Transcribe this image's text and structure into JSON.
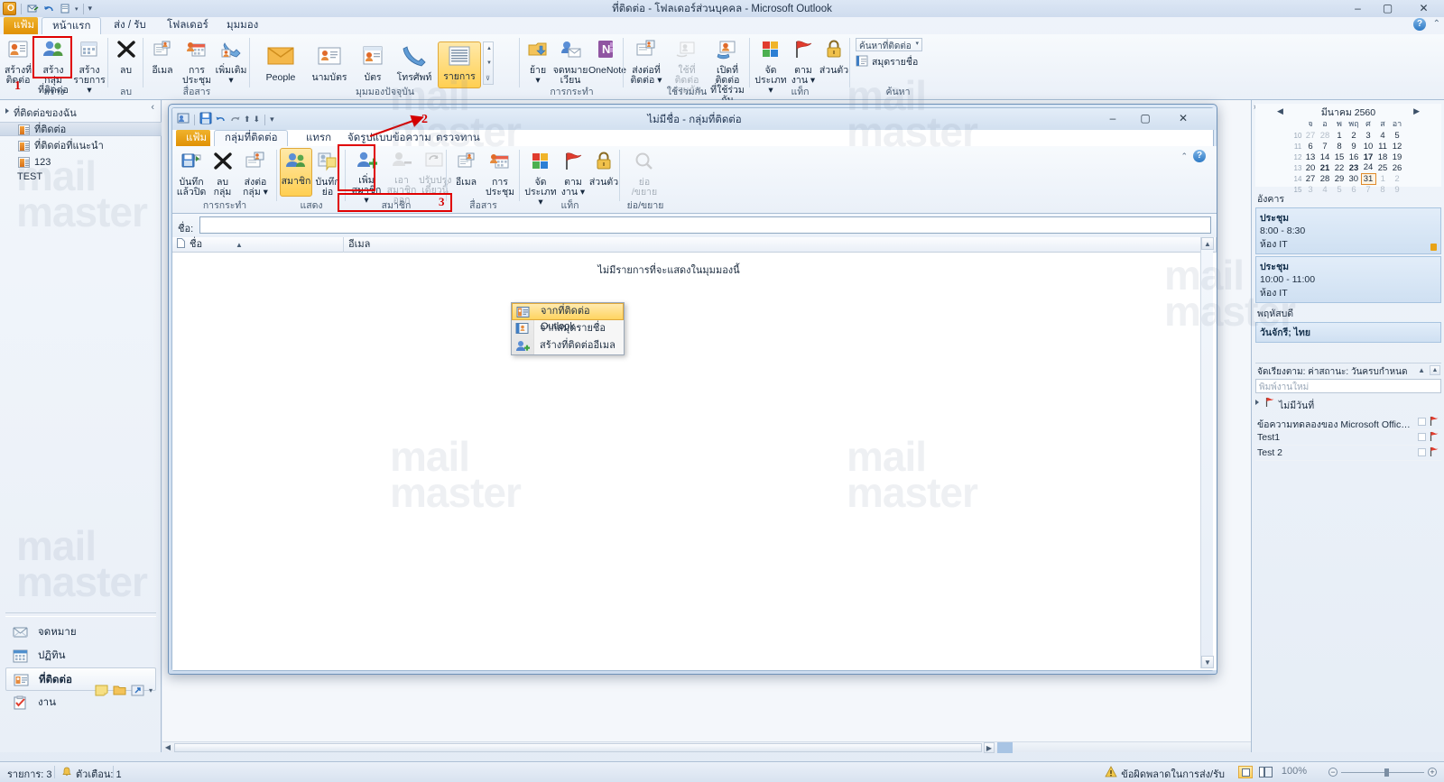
{
  "window": {
    "title": "ที่ติดต่อ - โฟลเดอร์ส่วนบุคคล  -  Microsoft Outlook",
    "minimize": "‒",
    "maximize": "▢",
    "close": "✕"
  },
  "qat": {
    "items": [
      "outlook-logo",
      "send-receive-icon",
      "undo-icon",
      "print-icon",
      "customize-icon"
    ]
  },
  "tabs": [
    {
      "id": "file",
      "label": "แฟ้ม"
    },
    {
      "id": "home",
      "label": "หน้าแรก"
    },
    {
      "id": "send",
      "label": "ส่ง / รับ"
    },
    {
      "id": "folder",
      "label": "โฟลเดอร์"
    },
    {
      "id": "view",
      "label": "มุมมอง"
    }
  ],
  "ribbon": {
    "groups": [
      {
        "name": "สร้าง",
        "buttons": [
          {
            "label": "สร้างที่\nติดต่อ",
            "icon": "new-contact-icon"
          },
          {
            "label": "สร้างกลุ่ม\nที่ติดต่อ",
            "icon": "new-contact-group-icon",
            "highlight": true
          },
          {
            "label": "สร้าง\nรายการ ▾",
            "icon": "new-items-icon"
          }
        ]
      },
      {
        "name": "ลบ",
        "buttons": [
          {
            "label": "ลบ",
            "icon": "delete-x-icon"
          }
        ]
      },
      {
        "name": "สื่อสาร",
        "buttons": [
          {
            "label": "อีเมล",
            "icon": "email-icon"
          },
          {
            "label": "การ\nประชุม",
            "icon": "meeting-icon"
          },
          {
            "label": "เพิ่มเติม\n▾",
            "icon": "more-icon"
          }
        ]
      },
      {
        "name": "มุมมองปัจจุบัน",
        "buttons": [
          {
            "label": "People",
            "icon": "people-view-icon"
          },
          {
            "label": "นามบัตร",
            "icon": "business-card-icon"
          },
          {
            "label": "บัตร",
            "icon": "card-icon"
          },
          {
            "label": "โทรศัพท์",
            "icon": "phone-icon"
          },
          {
            "label": "รายการ",
            "icon": "list-icon",
            "selected": true
          }
        ]
      },
      {
        "name": "การกระทำ",
        "buttons": [
          {
            "label": "ย้าย\n▾",
            "icon": "move-icon"
          },
          {
            "label": "จดหมาย\nเวียน",
            "icon": "mail-merge-icon"
          },
          {
            "label": "OneNote",
            "icon": "onenote-icon"
          }
        ]
      },
      {
        "name": "ใช้ร่วมกัน",
        "buttons": [
          {
            "label": "ส่งต่อที่\nติดต่อ ▾",
            "icon": "forward-contact-icon"
          },
          {
            "label": "ใช้ที่ติดต่อ\nร่วมกัน",
            "icon": "share-contacts-icon",
            "disabled": true
          },
          {
            "label": "เปิดที่ติดต่อ\nที่ใช้ร่วมกัน",
            "icon": "open-shared-contacts-icon"
          }
        ]
      },
      {
        "name": "แท็ก",
        "buttons": [
          {
            "label": "จัด\nประเภท ▾",
            "icon": "categorize-icon"
          },
          {
            "label": "ตาม\nงาน ▾",
            "icon": "follow-up-flag-icon"
          },
          {
            "label": "ส่วนตัว",
            "icon": "private-lock-icon"
          }
        ]
      },
      {
        "name": "ค้นหา",
        "search_placeholder": "ค้นหาที่ติดต่อ",
        "address_book_label": "สมุดรายชื่อ"
      }
    ]
  },
  "navpane": {
    "header": "ที่ติดต่อของฉัน",
    "collapse_icon": "chevron-left-icon",
    "items": [
      {
        "label": "ที่ติดต่อ",
        "selected": true
      },
      {
        "label": "ที่ติดต่อที่แนะนำ",
        "selected": false
      },
      {
        "label": "123",
        "selected": false
      }
    ],
    "extra_item": "TEST",
    "modules": [
      {
        "label": "จดหมาย",
        "icon": "mail-module-icon",
        "selected": false
      },
      {
        "label": "ปฏิทิน",
        "icon": "calendar-module-icon",
        "selected": false
      },
      {
        "label": "ที่ติดต่อ",
        "icon": "contacts-module-icon",
        "selected": true
      },
      {
        "label": "งาน",
        "icon": "tasks-module-icon",
        "selected": false
      }
    ],
    "module_icons": [
      "notes-icon",
      "folder-list-icon",
      "shortcuts-icon",
      "configure-icon"
    ]
  },
  "main": {
    "empty_text": "ไม่มีรายการที่จะแสดงในมุมมองนี้"
  },
  "todo": {
    "date_nav": {
      "month": "มีนาคม 2560",
      "prev": "◀",
      "next": "▶",
      "dow": [
        "จ",
        "อ",
        "พ",
        "พฤ",
        "ศ",
        "ส",
        "อา"
      ],
      "weeks": [
        {
          "wk": "10",
          "days": [
            {
              "d": "27",
              "out": true
            },
            {
              "d": "28",
              "out": true
            },
            {
              "d": "1"
            },
            {
              "d": "2"
            },
            {
              "d": "3"
            },
            {
              "d": "4"
            },
            {
              "d": "5"
            }
          ]
        },
        {
          "wk": "11",
          "days": [
            {
              "d": "6"
            },
            {
              "d": "7"
            },
            {
              "d": "8"
            },
            {
              "d": "9"
            },
            {
              "d": "10"
            },
            {
              "d": "11"
            },
            {
              "d": "12"
            }
          ]
        },
        {
          "wk": "12",
          "days": [
            {
              "d": "13"
            },
            {
              "d": "14"
            },
            {
              "d": "15"
            },
            {
              "d": "16"
            },
            {
              "d": "17",
              "bold": true
            },
            {
              "d": "18"
            },
            {
              "d": "19"
            }
          ]
        },
        {
          "wk": "13",
          "days": [
            {
              "d": "20"
            },
            {
              "d": "21",
              "bold": true
            },
            {
              "d": "22"
            },
            {
              "d": "23",
              "bold": true
            },
            {
              "d": "24"
            },
            {
              "d": "25"
            },
            {
              "d": "26"
            }
          ]
        },
        {
          "wk": "14",
          "days": [
            {
              "d": "27"
            },
            {
              "d": "28"
            },
            {
              "d": "29"
            },
            {
              "d": "30"
            },
            {
              "d": "31",
              "today": true
            },
            {
              "d": "1",
              "out": true
            },
            {
              "d": "2",
              "out": true
            }
          ]
        },
        {
          "wk": "15",
          "days": [
            {
              "d": "3",
              "out": true
            },
            {
              "d": "4",
              "out": true
            },
            {
              "d": "5",
              "out": true
            },
            {
              "d": "6",
              "out": true
            },
            {
              "d": "7",
              "out": true
            },
            {
              "d": "8",
              "out": true
            },
            {
              "d": "9",
              "out": true
            }
          ]
        }
      ]
    },
    "appointment_groups": [
      {
        "day": "อังคาร",
        "items": [
          {
            "subject": "ประชุม",
            "time": "8:00 - 8:30",
            "location": "ห้อง IT",
            "private": true
          },
          {
            "subject": "ประชุม",
            "time": "10:00 - 11:00",
            "location": "ห้อง IT",
            "private": false
          }
        ]
      },
      {
        "day": "พฤหัสบดี",
        "items": [
          {
            "subject": "วันจักรี; ไทย",
            "time": "",
            "location": "",
            "private": false
          }
        ]
      }
    ],
    "task_sort": "จัดเรียงตาม: ค่าสถานะ: วันครบกำหนด",
    "task_new_placeholder": "พิมพ์งานใหม่",
    "task_group": "ไม่มีวันที่",
    "tasks": [
      {
        "subject": "ข้อความทดลองของ Microsoft Office Ou..."
      },
      {
        "subject": "Test1"
      },
      {
        "subject": "Test 2"
      }
    ]
  },
  "status": {
    "items_label": "รายการ: 3",
    "reminders_label": "ตัวเตือน: 1",
    "error_label": "ข้อผิดพลาดในการส่ง/รับ",
    "zoom": "100%",
    "zoom_out": "−",
    "zoom_in": "+"
  },
  "dialog": {
    "title": "ไม่มีชื่อ - กลุ่มที่ติดต่อ",
    "minimize": "‒",
    "maximize": "▢",
    "close": "✕",
    "qat": [
      "contact-group-icon",
      "save-icon",
      "undo-icon",
      "redo-icon",
      "previous-icon",
      "next-icon",
      "customize-icon"
    ],
    "tabs": [
      {
        "id": "file",
        "label": "แฟ้ม"
      },
      {
        "id": "group",
        "label": "กลุ่มที่ติดต่อ"
      },
      {
        "id": "insert",
        "label": "แทรก"
      },
      {
        "id": "format",
        "label": "จัดรูปแบบข้อความ"
      },
      {
        "id": "review",
        "label": "ตรวจทาน"
      }
    ],
    "groups": [
      {
        "name": "การกระทำ",
        "buttons": [
          {
            "label": "บันทึก\nแล้วปิด",
            "icon": "save-close-icon"
          },
          {
            "label": "ลบ\nกลุ่ม",
            "icon": "delete-group-icon"
          },
          {
            "label": "ส่งต่อ\nกลุ่ม ▾",
            "icon": "forward-group-icon"
          }
        ]
      },
      {
        "name": "แสดง",
        "buttons": [
          {
            "label": "สมาชิก",
            "icon": "members-icon",
            "selected": true
          },
          {
            "label": "บันทึก\nย่อ",
            "icon": "notes-icon"
          }
        ]
      },
      {
        "name": "สมาชิก",
        "buttons": [
          {
            "label": "เพิ่ม\nสมาชิก ▾",
            "icon": "add-members-icon",
            "highlight": true
          },
          {
            "label": "เอาสมาชิก\nออก",
            "icon": "remove-member-icon",
            "disabled": true
          },
          {
            "label": "ปรับปรุง\nเดี๋ยวนี้",
            "icon": "update-now-icon",
            "disabled": true
          }
        ]
      },
      {
        "name": "สื่อสาร",
        "buttons": [
          {
            "label": "อีเมล",
            "icon": "email-icon"
          },
          {
            "label": "การ\nประชุม",
            "icon": "meeting-icon"
          }
        ]
      },
      {
        "name": "แท็ก",
        "buttons": [
          {
            "label": "จัด\nประเภท ▾",
            "icon": "categorize-icon"
          },
          {
            "label": "ตาม\nงาน ▾",
            "icon": "follow-up-flag-icon"
          },
          {
            "label": "ส่วนตัว",
            "icon": "private-lock-icon"
          }
        ]
      },
      {
        "name": "ย่อ/ขยาย",
        "buttons": [
          {
            "label": "ย่อ\n/ขยาย",
            "icon": "zoom-icon",
            "disabled": true
          }
        ]
      }
    ],
    "name_label": "ชื่อ:",
    "name_value": "",
    "columns": [
      {
        "label": "ชื่อ",
        "sort": "▲"
      },
      {
        "label": "อีเมล"
      }
    ],
    "empty_text": "ไม่มีรายการที่จะแสดงในมุมมองนี้",
    "help_icon": "?",
    "dropdown": [
      {
        "label": "จากที่ติดต่อ Outlook",
        "icon": "outlook-contacts-icon",
        "highlighted": true
      },
      {
        "label": "จากสมุดรายชื่อ",
        "icon": "address-book-icon",
        "highlighted": false
      },
      {
        "label": "สร้างที่ติดต่ออีเมล",
        "icon": "new-email-contact-icon",
        "highlighted": false
      }
    ]
  },
  "annotations": [
    {
      "number": "1"
    },
    {
      "number": "2"
    },
    {
      "number": "3"
    }
  ],
  "watermark": {
    "line1": "mail",
    "line2": "master"
  },
  "colors": {
    "accent_orange": "#e8a317",
    "highlight_red": "#e00000",
    "selection_yellow": "#ffd460",
    "titlebar_blue": "#cfdcee"
  }
}
